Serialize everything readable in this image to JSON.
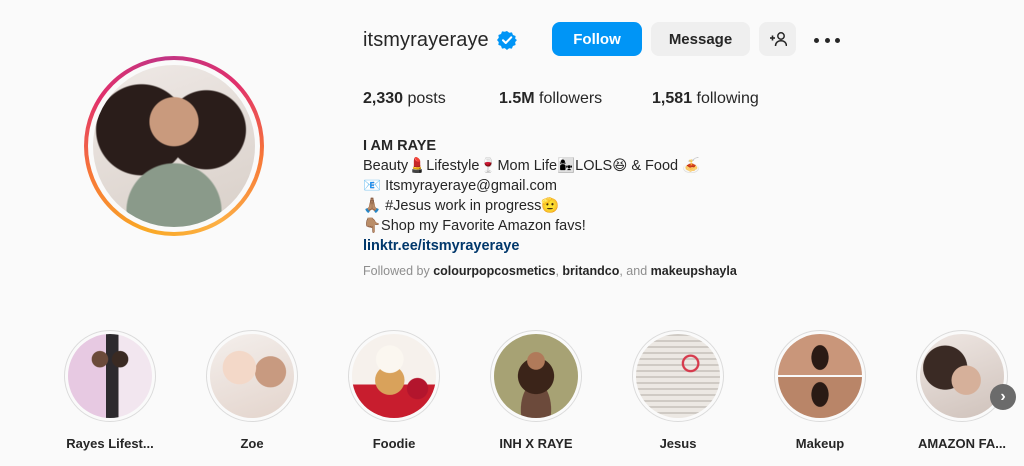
{
  "profile": {
    "username": "itsmyrayeraye",
    "verified": true,
    "buttons": {
      "follow": "Follow",
      "message": "Message",
      "add_user_icon": "+👤"
    },
    "stats": {
      "posts_count": "2,330",
      "posts_label": "posts",
      "followers_count": "1.5M",
      "followers_label": "followers",
      "following_count": "1,581",
      "following_label": "following"
    },
    "bio": {
      "name": "I AM RAYE",
      "line1": "Beauty💄Lifestyle🍷Mom Life👩‍👧LOLS😆 & Food 🍝",
      "line2": "📧 Itsmyrayeraye@gmail.com",
      "line3": "🙏🏽 #Jesus work in progress🫡",
      "line4": "👇🏽Shop my Favorite Amazon favs!",
      "link": "linktr.ee/itsmyrayeraye"
    },
    "followed_by": {
      "prefix": "Followed by",
      "user1": "colourpopcosmetics",
      "sep1": ",",
      "user2": "britandco",
      "sep2": ", and",
      "user3": "makeupshayla"
    }
  },
  "highlights": [
    {
      "label": "Rayes Lifest...",
      "icon": "highlight-cover-lifestyle"
    },
    {
      "label": "Zoe",
      "icon": "highlight-cover-zoe"
    },
    {
      "label": "Foodie",
      "icon": "highlight-cover-foodie"
    },
    {
      "label": "INH X RAYE",
      "icon": "highlight-cover-inh"
    },
    {
      "label": "Jesus",
      "icon": "highlight-cover-jesus"
    },
    {
      "label": "Makeup",
      "icon": "highlight-cover-makeup"
    },
    {
      "label": "AMAZON FA...",
      "icon": "highlight-cover-amazon"
    }
  ],
  "colors": {
    "accent": "#0095f6",
    "link": "#00376b",
    "verified": "#0095f6"
  }
}
